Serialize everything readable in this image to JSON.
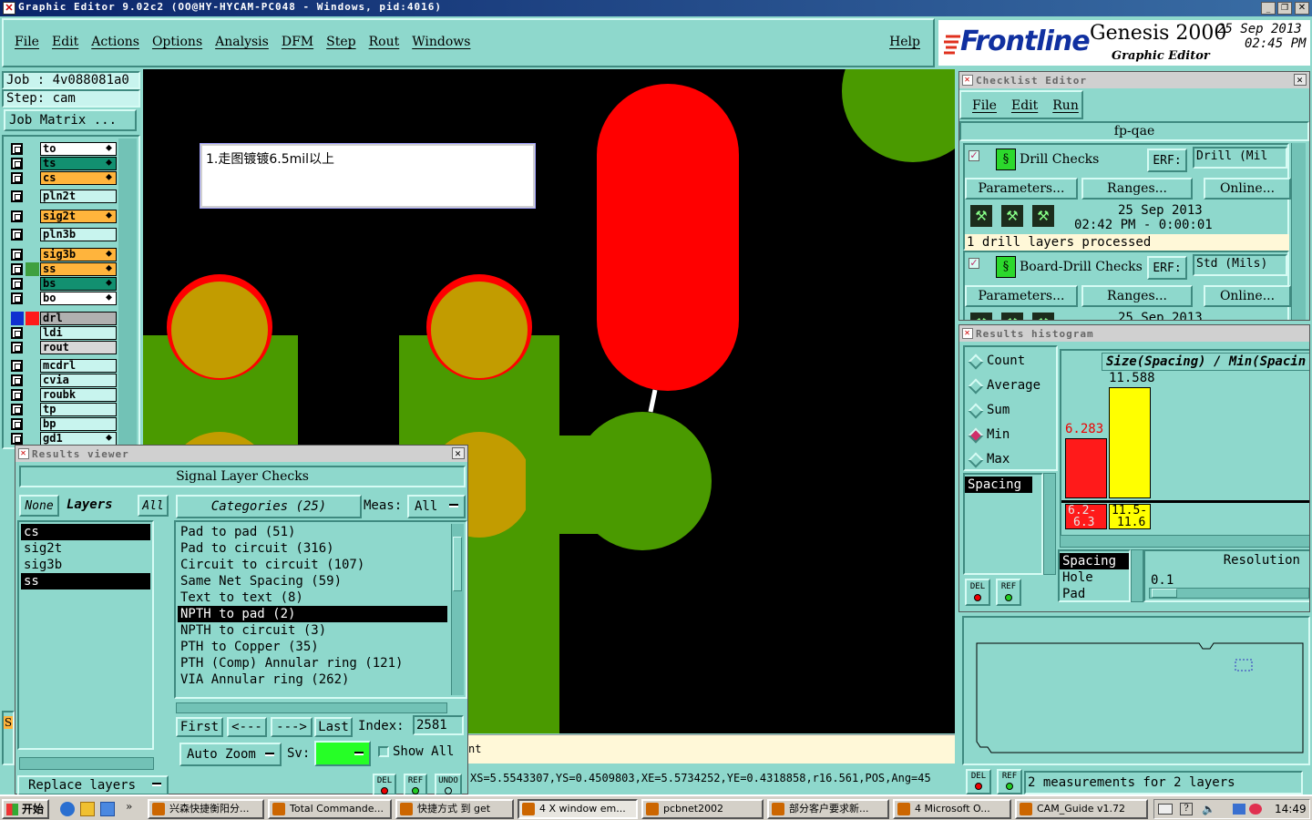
{
  "window": {
    "title": "Graphic Editor 9.02c2 (OO@HY-HYCAM-PC048 - Windows, pid:4016)"
  },
  "menu": {
    "items": [
      "File",
      "Edit",
      "Actions",
      "Options",
      "Analysis",
      "DFM",
      "Step",
      "Rout",
      "Windows"
    ],
    "help": "Help"
  },
  "brand": {
    "logo": "Frontline",
    "product": "Genesis 2000",
    "subtitle": "Graphic Editor",
    "date": "25 Sep 2013",
    "time": "02:45 PM"
  },
  "job": {
    "job_label": "Job : 4v088081a0",
    "step_label": "Step: cam",
    "matrix_button": "Job Matrix ..."
  },
  "layers": [
    {
      "name": "to",
      "color": "#ffffff",
      "flag": true
    },
    {
      "name": "ts",
      "color": "#129070",
      "flag": true
    },
    {
      "name": "cs",
      "color": "#ffb43c",
      "flag": true
    },
    {
      "name": "pln2t",
      "color": "#c8f4ee",
      "flag": false
    },
    {
      "name": "sig2t",
      "color": "#ffb43c",
      "flag": true
    },
    {
      "name": "pln3b",
      "color": "#c8f4ee",
      "flag": false
    },
    {
      "name": "sig3b",
      "color": "#ffb43c",
      "flag": true
    },
    {
      "name": "ss",
      "color": "#ffb43c",
      "flag": true
    },
    {
      "name": "bs",
      "color": "#129070",
      "flag": true
    },
    {
      "name": "bo",
      "color": "#ffffff",
      "flag": true
    },
    {
      "name": "drl",
      "color": "#b0b0b0",
      "flag": false
    },
    {
      "name": "ldi",
      "color": "#c8f4ee",
      "flag": false
    },
    {
      "name": "rout",
      "color": "#d8d8d8",
      "flag": false
    },
    {
      "name": "mcdrl",
      "color": "#c8f4ee",
      "flag": false
    },
    {
      "name": "cvia",
      "color": "#c8f4ee",
      "flag": false
    },
    {
      "name": "roubk",
      "color": "#c8f4ee",
      "flag": false
    },
    {
      "name": "tp",
      "color": "#c8f4ee",
      "flag": false
    },
    {
      "name": "bp",
      "color": "#c8f4ee",
      "flag": false
    },
    {
      "name": "gd1",
      "color": "#c8f4ee",
      "flag": true
    }
  ],
  "canvas": {
    "note": "1.走图镀镀6.5mil以上",
    "status_line": "XS=5.5543307,YS=0.4509803,XE=5.5734252,YE=0.4318858,r16.561,POS,Ang=45",
    "side_letter": "S"
  },
  "results_viewer": {
    "title": "Results viewer",
    "header": "Signal Layer Checks",
    "none_btn": "None",
    "layers_label": "Layers",
    "all_btn": "All",
    "layer_list": [
      {
        "name": "cs",
        "selected": true
      },
      {
        "name": "sig2t",
        "selected": false
      },
      {
        "name": "sig3b",
        "selected": false
      },
      {
        "name": "ss",
        "selected": true
      }
    ],
    "categories_label": "Categories (25)",
    "meas_label": "Meas:",
    "meas_value": "All",
    "categories": [
      {
        "text": "Pad to pad (51)",
        "selected": false
      },
      {
        "text": "Pad to circuit (316)",
        "selected": false
      },
      {
        "text": "Circuit to circuit (107)",
        "selected": false
      },
      {
        "text": "Same Net Spacing (59)",
        "selected": false
      },
      {
        "text": "Text to text (8)",
        "selected": false
      },
      {
        "text": "NPTH to pad (2)",
        "selected": true
      },
      {
        "text": "NPTH to circuit (3)",
        "selected": false
      },
      {
        "text": "PTH to Copper (35)",
        "selected": false
      },
      {
        "text": "PTH (Comp) Annular ring (121)",
        "selected": false
      },
      {
        "text": "VIA Annular ring (262)",
        "selected": false
      }
    ],
    "first_btn": "First",
    "prev_btn": "<---",
    "next_btn": "--->",
    "last_btn": "Last",
    "index_label": "Index:",
    "index_value": "2581",
    "zoom_option": "Auto Zoom",
    "sv_label": "Sv:",
    "show_all": "Show All",
    "replace_layers": "Replace layers",
    "del": "DEL",
    "ref": "REF",
    "undo": "UNDO",
    "partial_text": "nt"
  },
  "checklist": {
    "title": "Checklist Editor",
    "menu": [
      "File",
      "Edit",
      "Run"
    ],
    "name": "fp-qae",
    "checks": [
      {
        "name": "Drill Checks",
        "erf_label": "ERF:",
        "erf_value": "Drill (Mil",
        "params": "Parameters...",
        "ranges": "Ranges...",
        "online": "Online...",
        "date": "25 Sep 2013",
        "time": "02:42 PM - 0:00:01",
        "status": "1 drill layers processed"
      },
      {
        "name": "Board-Drill Checks",
        "erf_label": "ERF:",
        "erf_value": "Std (Mils)",
        "params": "Parameters...",
        "ranges": "Ranges...",
        "online": "Online...",
        "date": "25 Sep 2013"
      }
    ]
  },
  "histogram": {
    "title": "Results histogram",
    "options": [
      {
        "label": "Count",
        "on": false
      },
      {
        "label": "Average",
        "on": false
      },
      {
        "label": "Sum",
        "on": false
      },
      {
        "label": "Min",
        "on": true
      },
      {
        "label": "Max",
        "on": false
      }
    ],
    "chart_title": "Size(Spacing) / Min(Spacin",
    "bars": [
      {
        "value": "6.283",
        "range_top": "6.2-",
        "range_bottom": "6.3",
        "color": "#ff1a1a",
        "frac": 0.54
      },
      {
        "value": "11.588",
        "range_top": "11.5-",
        "range_bottom": "11.6",
        "color": "#ffff00",
        "frac": 1.0
      }
    ],
    "measure_list": [
      "Spacing"
    ],
    "type_list": [
      {
        "name": "Spacing",
        "selected": true
      },
      {
        "name": "Hole",
        "selected": false
      },
      {
        "name": "Pad",
        "selected": false
      }
    ],
    "resolution_label": "Resolution",
    "resolution_value": "0.1",
    "del": "DEL",
    "ref": "REF",
    "measurements_text": "2 measurements for 2 layers"
  },
  "taskbar": {
    "start": "开始",
    "tasks": [
      "兴森快捷衡阳分...",
      "Total Commande...",
      "快捷方式 到 get",
      "4 X window em...",
      "pcbnet2002",
      "部分客户要求新...",
      "4 Microsoft O...",
      "CAM_Guide v1.72"
    ],
    "clock": "14:49"
  }
}
